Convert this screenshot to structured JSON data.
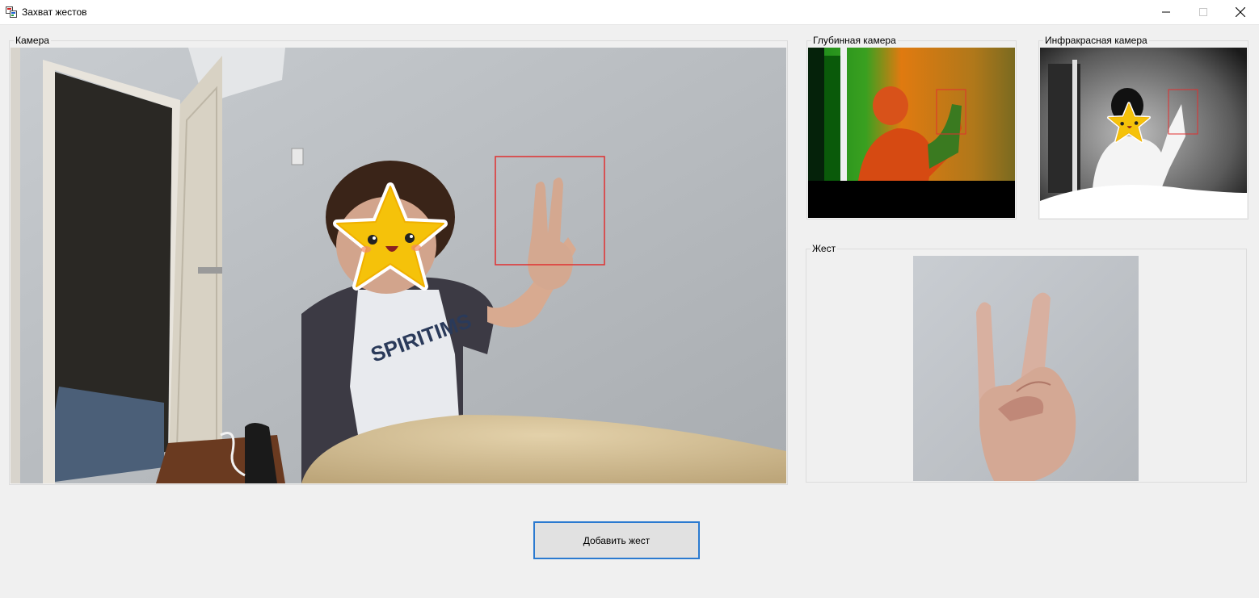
{
  "window": {
    "title": "Захват жестов"
  },
  "groups": {
    "camera": {
      "label": "Камера"
    },
    "depth": {
      "label": "Глубинная камера"
    },
    "infrared": {
      "label": "Инфракрасная камера"
    },
    "gesture": {
      "label": "Жест"
    }
  },
  "buttons": {
    "add_gesture": "Добавить жест"
  },
  "colors": {
    "focus_border": "#2b7ad0",
    "detection_box": "#e03030"
  }
}
